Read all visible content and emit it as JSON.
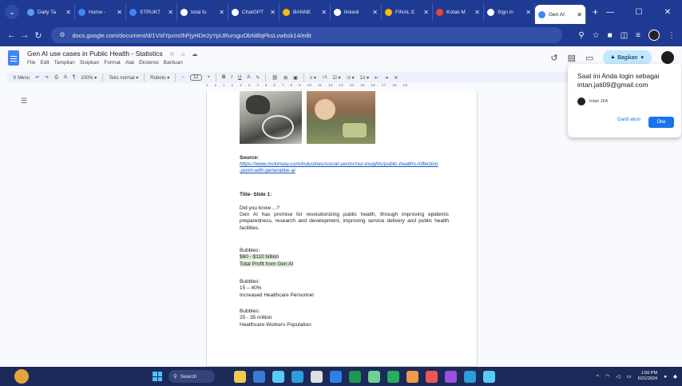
{
  "browser": {
    "tabs": [
      {
        "title": "Daily Ta",
        "color": "#5e97f6",
        "active": false
      },
      {
        "title": "Home -",
        "color": "#4285f4",
        "active": false
      },
      {
        "title": "STRUKT",
        "color": "#4285f4",
        "active": false
      },
      {
        "title": "total fu",
        "color": "#ffffff",
        "active": false
      },
      {
        "title": "ChatGPT",
        "color": "#ffffff",
        "active": false
      },
      {
        "title": "BANNE",
        "color": "#fbbc04",
        "active": false
      },
      {
        "title": "linkedi",
        "color": "#ffffff",
        "active": false
      },
      {
        "title": "FINAL E",
        "color": "#fbbc04",
        "active": false
      },
      {
        "title": "Kotak M",
        "color": "#ea4335",
        "active": false
      },
      {
        "title": "Sign in",
        "color": "#ffffff",
        "active": false
      },
      {
        "title": "Gen AI",
        "color": "#4285f4",
        "active": true
      }
    ],
    "new_tab": "+",
    "url": "docs.google.com/document/d/1VIdYpxm0hPjyHDe2yYpURursguObN8lqPksLvwbsk14/edit",
    "window_controls": {
      "minimize": "—",
      "restore": "☐",
      "close": "✕"
    }
  },
  "docs": {
    "title": "Gen AI use cases in Public Health - Statistics",
    "menu": [
      "File",
      "Edit",
      "Tampilan",
      "Sisipkan",
      "Format",
      "Alat",
      "Ekstensi",
      "Bantuan"
    ],
    "share_label": "Bagikan",
    "toolbar": {
      "menus": "Menu",
      "zoom": "100%",
      "style": "Teks normal",
      "font": "Roboto",
      "font_size": "12"
    },
    "ruler": "1 . . 2 . . 1 . . 1 . . 2 . . 3 . . 4 . . 5 . . 6 . . 7 . . 8 . . 9 . . 10 . . 11 . . 12 . . 13 . . 14 . . 15 . . 16 . . 17 . . 18 . . 19"
  },
  "document": {
    "source_label": "Source:",
    "source_link_1": "https://www.mckinsey.com/industries/social-sector/our-insights/public-healths-inflection",
    "source_link_2": "-point-with-generative-ai",
    "slide_title": "Title- Slide 1:",
    "did_you_know": "Did you know ...?",
    "body": "Gen AI has promise for revolutionizing public health, through improving epidemic preparedness, research and development, improving service delivery and public health facilities.",
    "bubbles": [
      {
        "label": "Bubbles:",
        "value": "$60 - $110 billion",
        "desc": "Total Profit from Gen AI",
        "highlight": true
      },
      {
        "label": "Bubbles:",
        "value": "15 – 40%",
        "desc": "Increased Healthcare Personnel",
        "highlight": false
      },
      {
        "label": "Bubbles:",
        "value": "25 - 35 million",
        "desc": "Healthcare Workers Population",
        "highlight": false
      }
    ]
  },
  "account_popover": {
    "message": "Saat ini Anda login sebagai intan.jati09@gmail.com",
    "account_name": "Intan JFA",
    "switch_label": "Ganti akun",
    "ok_label": "Oke"
  },
  "taskbar": {
    "search_label": "Search",
    "time": "1:56 PM",
    "date": "5/21/2024",
    "apps": [
      "#f2c94c",
      "#3a7bd5",
      "#56ccf2",
      "#2d9cdb",
      "#e0e0e0",
      "#2f80ed",
      "#219653",
      "#6fcf97",
      "#27ae60",
      "#f2994a",
      "#eb5757",
      "#9b51e0",
      "#2d9cdb",
      "#56ccf2"
    ]
  }
}
